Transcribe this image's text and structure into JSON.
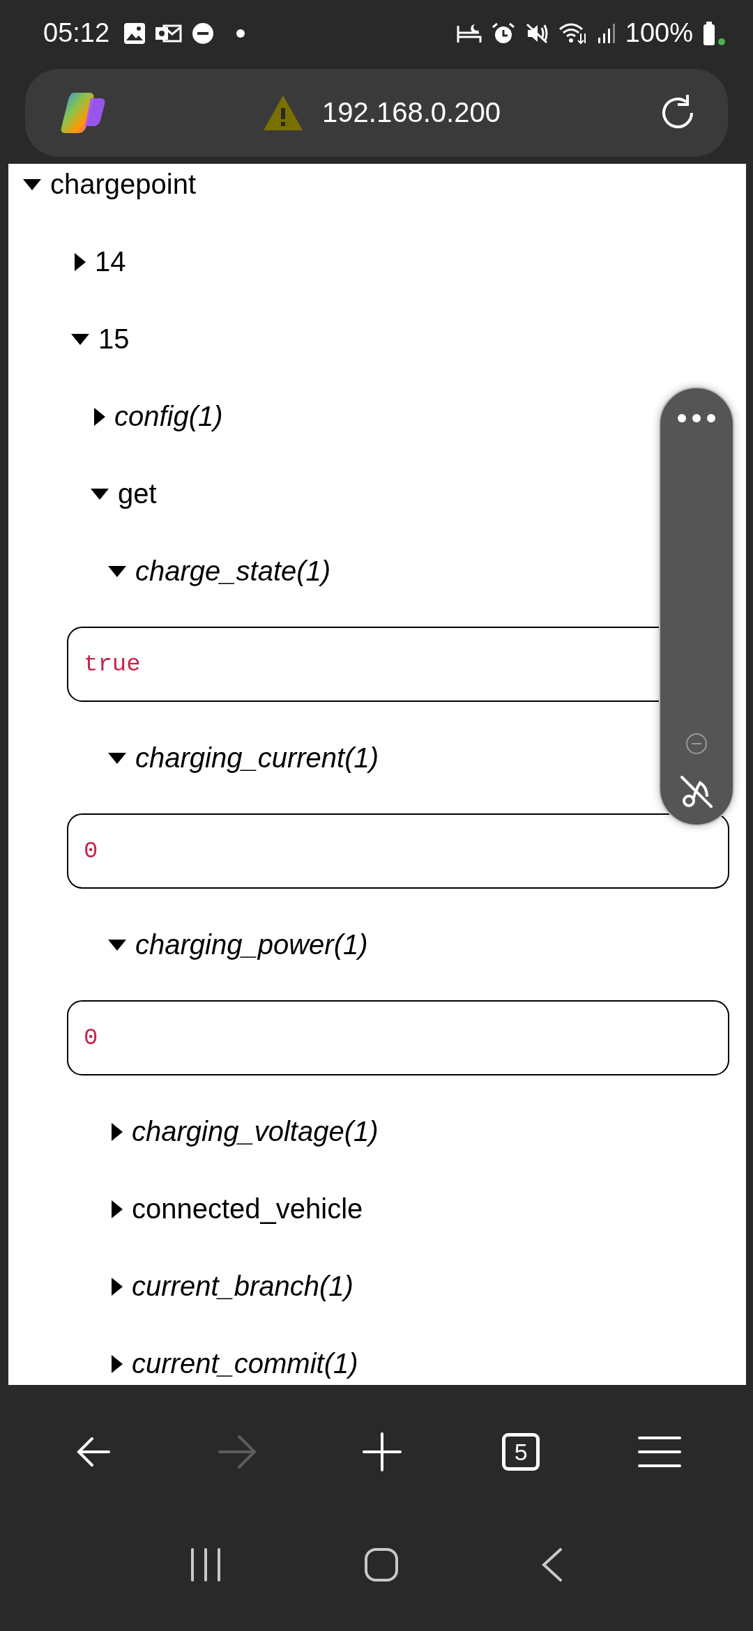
{
  "status_bar": {
    "time": "05:12",
    "battery": "100%"
  },
  "address_bar": {
    "url": "192.168.0.200"
  },
  "tree": [
    {
      "label": "chargepoint",
      "kind": "group",
      "expanded": true,
      "children": [
        {
          "label": "14",
          "kind": "group",
          "expanded": false
        },
        {
          "label": "15",
          "kind": "group",
          "expanded": true,
          "children": [
            {
              "label": "config(1)",
              "kind": "topic",
              "expanded": false
            },
            {
              "label": "get",
              "kind": "group",
              "expanded": true,
              "children": [
                {
                  "label": "charge_state(1)",
                  "kind": "topic",
                  "expanded": true,
                  "value": "true"
                },
                {
                  "label": "charging_current(1)",
                  "kind": "topic",
                  "expanded": true,
                  "value": "0"
                },
                {
                  "label": "charging_power(1)",
                  "kind": "topic",
                  "expanded": true,
                  "value": "0"
                },
                {
                  "label": "charging_voltage(1)",
                  "kind": "topic",
                  "expanded": false
                },
                {
                  "label": "connected_vehicle",
                  "kind": "group",
                  "expanded": false
                },
                {
                  "label": "current_branch(1)",
                  "kind": "topic",
                  "expanded": false
                },
                {
                  "label": "current_commit(1)",
                  "kind": "topic",
                  "expanded": false
                }
              ]
            }
          ]
        }
      ]
    }
  ],
  "toolbar": {
    "tab_count": "5",
    "forward_disabled": true
  }
}
